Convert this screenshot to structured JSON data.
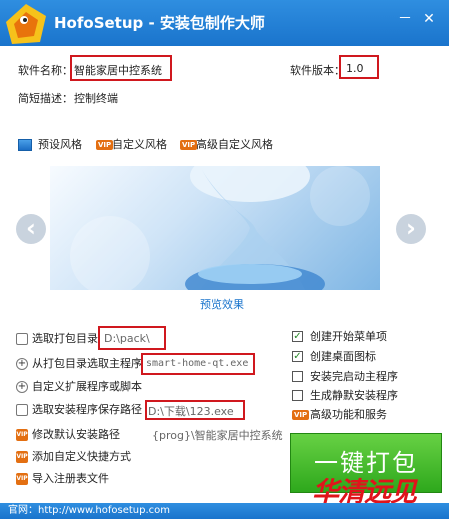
{
  "window": {
    "title": "HofoSetup - 安装包制作大师",
    "minimize_glyph": "－",
    "close_glyph": "✕"
  },
  "form": {
    "name_label": "软件名称：",
    "name_value": "智能家居中控系统",
    "version_label": "软件版本：",
    "version_value": "1.0",
    "desc_label": "简短描述：",
    "desc_value": "控制终端"
  },
  "tabs": [
    {
      "label": "预设风格",
      "icon": "preset-style-icon",
      "vip": ""
    },
    {
      "label": "自定义风格",
      "icon": "vip-icon",
      "vip": "VIP"
    },
    {
      "label": "高级自定义风格",
      "icon": "vip-icon",
      "vip": "VIP"
    }
  ],
  "preview": {
    "prev_glyph": "‹",
    "next_glyph": "›",
    "link": "预览效果"
  },
  "options": [
    {
      "label": "选取打包目录",
      "value": "D:\\pack\\",
      "icon": "folder-icon"
    },
    {
      "label": "从打包目录选取主程序",
      "value": "smart-home-qt.exe",
      "icon": "plus-circle-icon"
    },
    {
      "label": "自定义扩展程序或脚本",
      "value": "",
      "icon": "plus-circle-icon"
    },
    {
      "label": "选取安装程序保存路径",
      "value": "D:\\下载\\123.exe",
      "icon": "folder-icon"
    },
    {
      "label": "修改默认安装路径",
      "value": "{prog}\\智能家居中控系统",
      "icon": "vip-icon"
    },
    {
      "label": "添加自定义快捷方式",
      "value": "",
      "icon": "vip-icon"
    },
    {
      "label": "导入注册表文件",
      "value": "",
      "icon": "vip-icon"
    }
  ],
  "checks": [
    {
      "label": "创建开始菜单项",
      "checked": true
    },
    {
      "label": "创建桌面图标",
      "checked": true
    },
    {
      "label": "安装完启动主程序",
      "checked": false
    },
    {
      "label": "生成静默安装程序",
      "checked": false
    },
    {
      "label": "高级功能和服务",
      "checked": null
    }
  ],
  "build_button": "一键打包",
  "status": {
    "website": "官网：http://www.hofosetup.com"
  },
  "watermark": "华清远见",
  "vip_text": "VIP",
  "check_glyph": "✓",
  "plus_glyph": "+",
  "colors": {
    "titlebar": "#1a74cc",
    "highlight_box": "#d0181e",
    "build_button": "#2ea81c"
  }
}
